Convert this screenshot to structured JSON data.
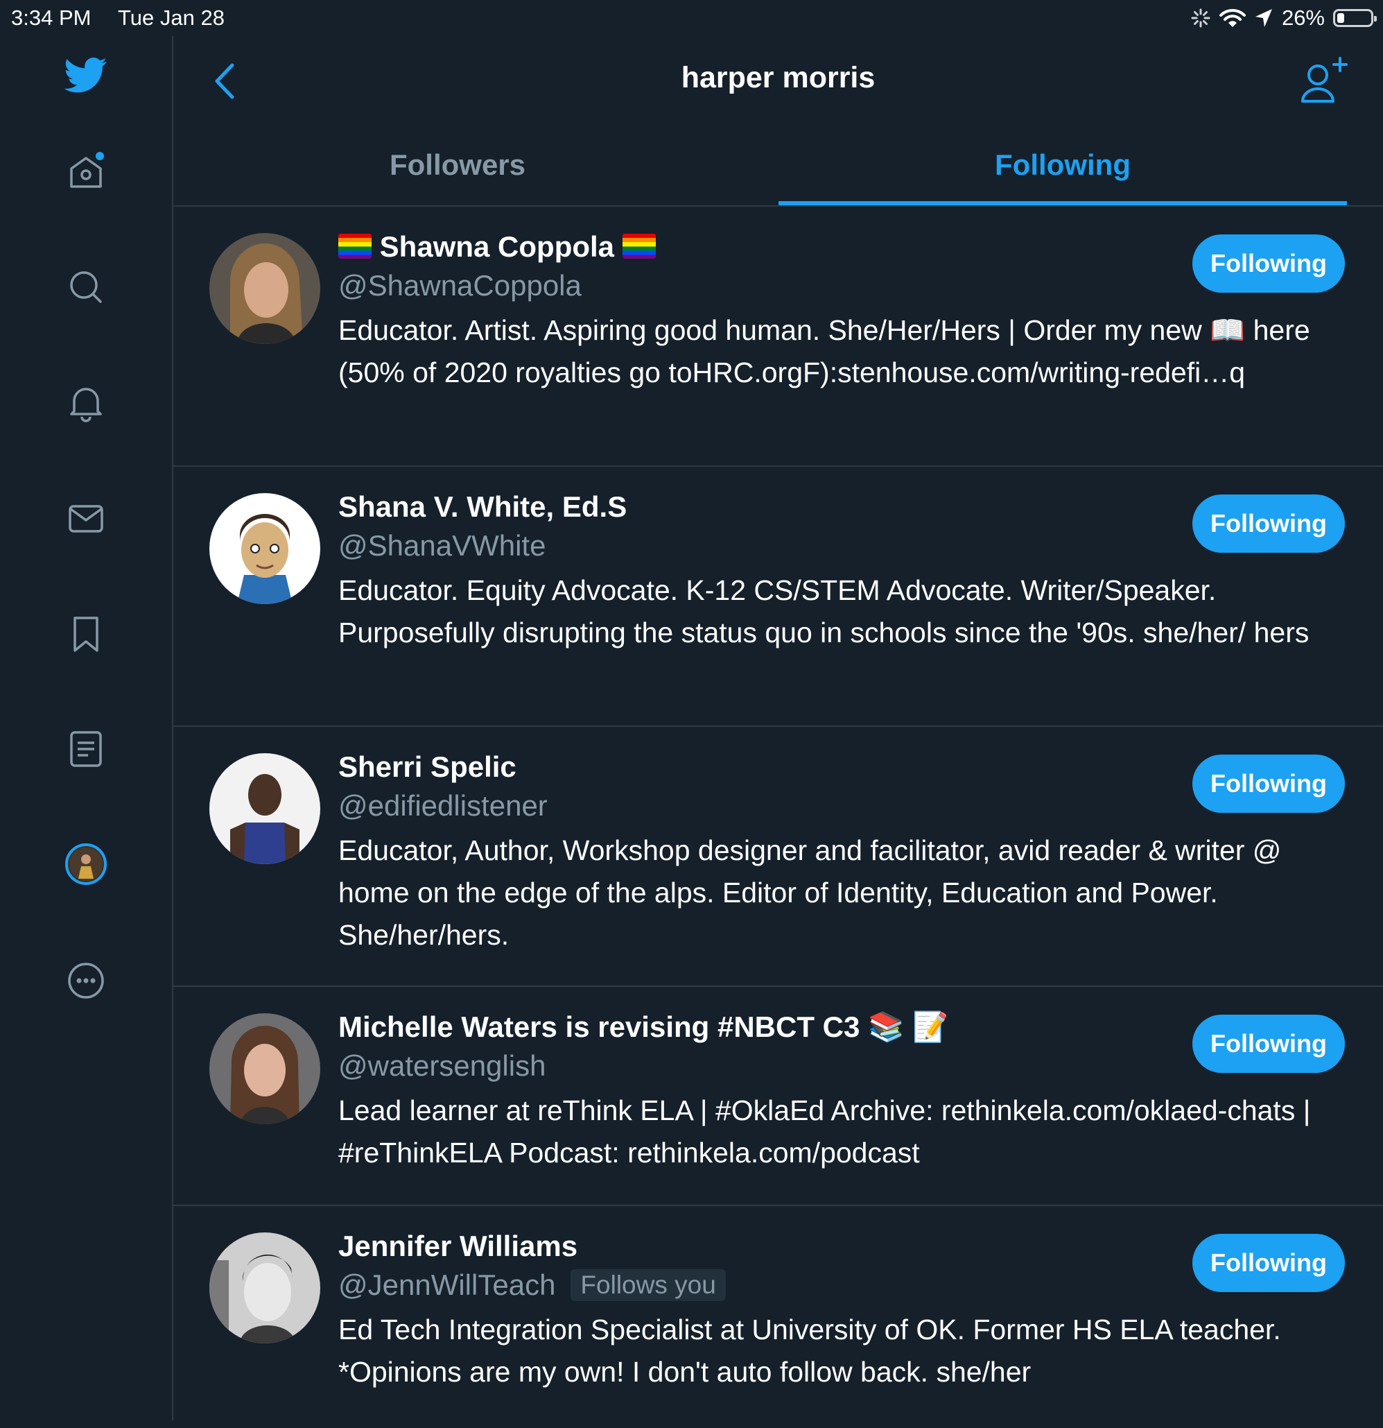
{
  "status_bar": {
    "time": "3:34 PM",
    "date": "Tue Jan 28",
    "battery_percent": "26%"
  },
  "header": {
    "title": "harper morris"
  },
  "tabs": [
    {
      "label": "Followers",
      "active": false
    },
    {
      "label": "Following",
      "active": true
    }
  ],
  "users": [
    {
      "name": "Shawna Coppola",
      "handle": "@ShawnaCoppola",
      "bio": "Educator. Artist. Aspiring good human. She/Her/Hers | Order my new 📖 here (50% of 2020 royalties go toHRC.orgF):stenhouse.com/writing-redefi…q",
      "button": "Following"
    },
    {
      "name": "Shana V. White, Ed.S",
      "handle": "@ShanaVWhite",
      "bio": "Educator. Equity Advocate. K-12 CS/STEM Advocate. Writer/Speaker. Purposefully disrupting the status quo in schools since the '90s. she/her/ hers",
      "button": "Following"
    },
    {
      "name": "Sherri Spelic",
      "handle": "@edifiedlistener",
      "bio": "Educator, Author, Workshop designer and facilitator, avid reader & writer @ home on the edge of the alps. Editor of Identity, Education and Power. She/her/hers.",
      "button": "Following"
    },
    {
      "name": "Michelle Waters is revising #NBCT C3 📚 📝",
      "handle": "@watersenglish",
      "bio": "Lead learner at reThink ELA | #OklaEd Archive: rethinkela.com/oklaed-chats | #reThinkELA Podcast: rethinkela.com/podcast",
      "button": "Following"
    },
    {
      "name": "Jennifer Williams",
      "handle": "@JennWillTeach",
      "follows_you": "Follows you",
      "bio": "Ed Tech Integration Specialist at University of OK. Former HS ELA teacher. *Opinions are my own! I don't auto follow back. she/her",
      "button": "Following"
    }
  ],
  "colors": {
    "background": "#15202b",
    "accent": "#1da1f2",
    "muted": "#8899a6",
    "divider": "#2f3a45"
  },
  "icons": [
    "twitter-logo-icon",
    "home-icon",
    "search-icon",
    "notifications-icon",
    "messages-icon",
    "bookmarks-icon",
    "lists-icon",
    "profile-avatar",
    "more-icon",
    "back-icon",
    "add-user-icon",
    "wifi-icon",
    "location-icon",
    "loading-icon",
    "battery-icon"
  ]
}
